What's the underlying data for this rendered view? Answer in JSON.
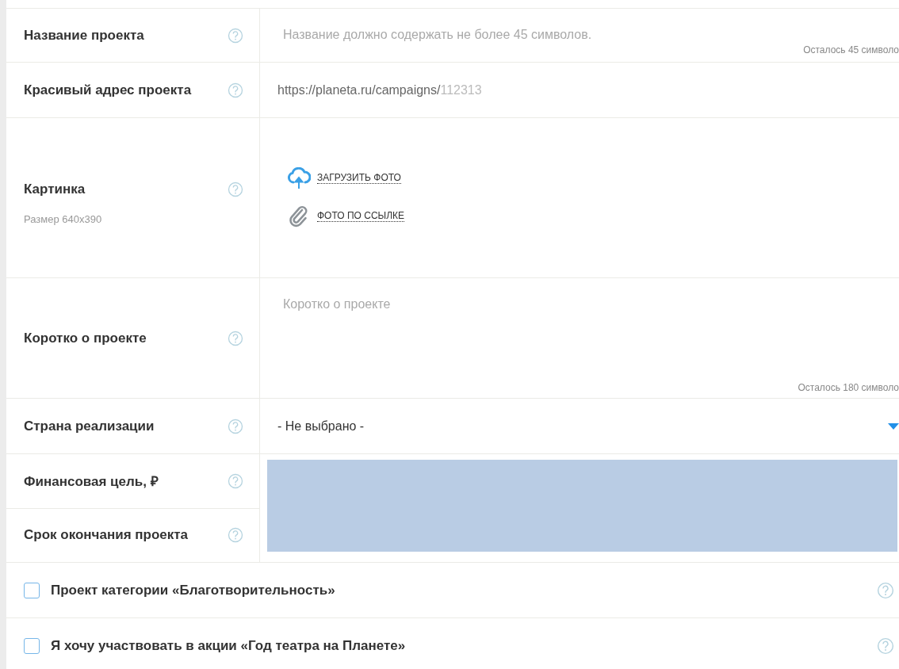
{
  "fields": [
    {
      "kind": "text",
      "label": "Название проекта",
      "placeholder": "Название должно содержать не более 45 символов.",
      "counter": "Осталось 45 символо"
    },
    {
      "kind": "url",
      "label": "Красивый адрес проекта",
      "prefix": "https://planeta.ru/campaigns/",
      "value": "112313"
    },
    {
      "kind": "image",
      "label": "Картинка",
      "hint": "Размер 640x390",
      "actions": [
        {
          "kind": "upload",
          "label": "ЗАГРУЗИТЬ ФОТО"
        },
        {
          "kind": "link",
          "label": "ФОТО ПО ССЫЛКЕ"
        }
      ]
    },
    {
      "kind": "textarea",
      "label": "Коротко о проекте",
      "placeholder": "Коротко о проекте",
      "counter": "Осталось 180 символо"
    },
    {
      "kind": "select",
      "label": "Страна реализации",
      "value": "- Не выбрано -"
    }
  ],
  "redacted_fields": [
    "Финансовая цель, ₽",
    "Срок окончания проекта"
  ],
  "checkboxes": [
    {
      "label": "Проект категории «Благотворительность»",
      "checked": false
    },
    {
      "label": "Я хочу участвовать в акции «Год театра на Планете»",
      "checked": false
    }
  ]
}
